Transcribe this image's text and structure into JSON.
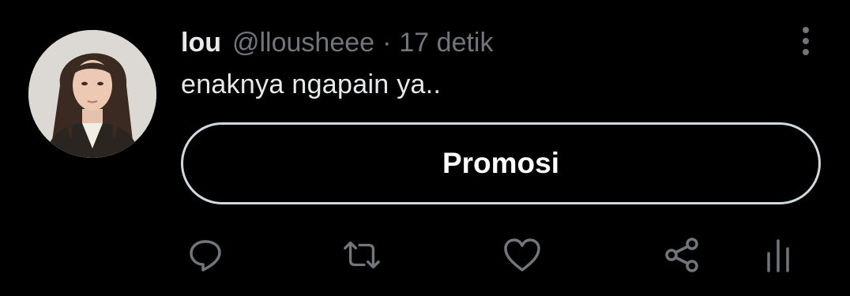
{
  "tweet": {
    "display_name": "lou",
    "handle": "@llousheee",
    "separator": "·",
    "timestamp": "17 detik",
    "text": "enaknya ngapain ya..",
    "promo_label": "Promosi"
  },
  "icons": {
    "more": "more-vertical-icon",
    "reply": "reply-icon",
    "retweet": "retweet-icon",
    "like": "heart-icon",
    "share": "share-icon",
    "analytics": "analytics-icon"
  },
  "colors": {
    "background": "#000000",
    "text_primary": "#e7e9ea",
    "text_secondary": "#71767b",
    "promo_border": "#cfd9de"
  }
}
